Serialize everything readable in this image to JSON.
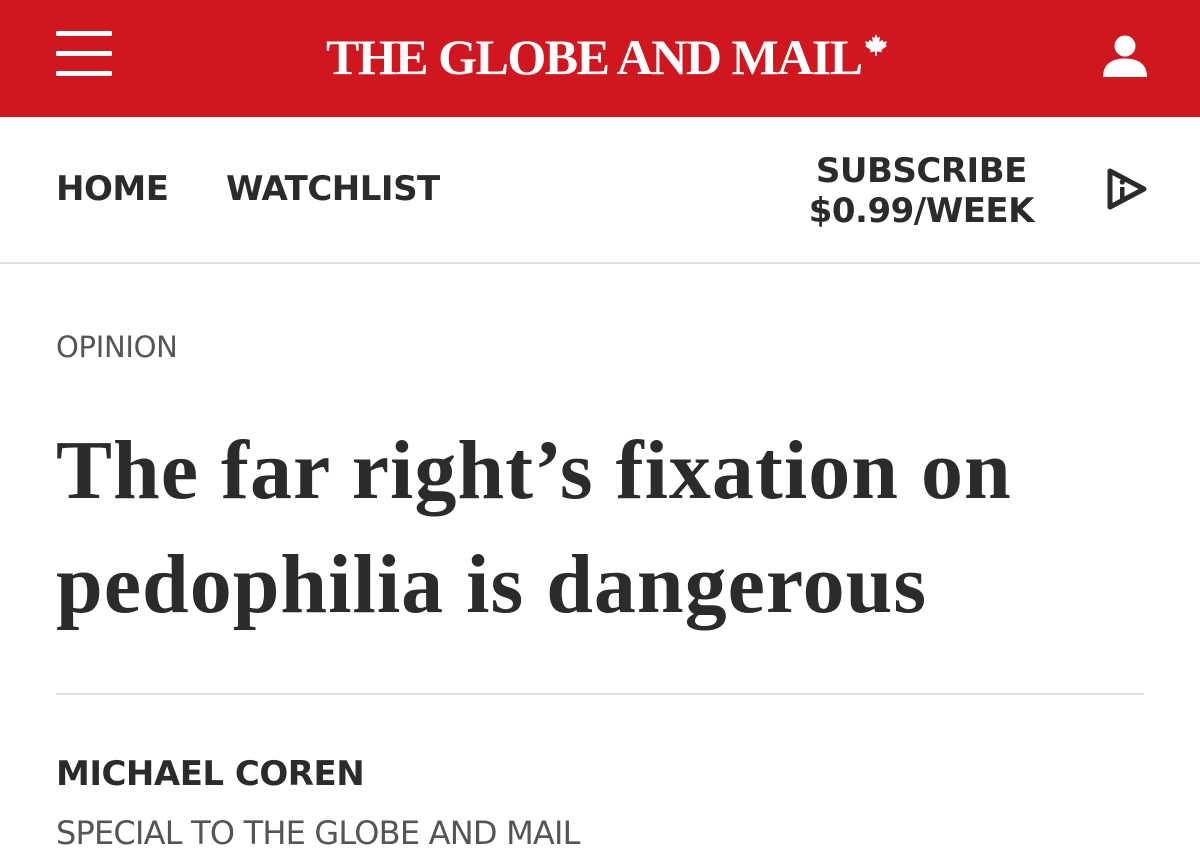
{
  "masthead": {
    "logo_text": "THE GLOBE AND MAIL",
    "menu_icon": "hamburger-menu-icon",
    "logo_icon": "maple-leaf-icon",
    "account_icon": "user-account-icon",
    "background_color": "#d0161e"
  },
  "nav": {
    "home_label": "HOME",
    "watchlist_label": "WATCHLIST",
    "subscribe_line1": "SUBSCRIBE",
    "subscribe_line2": "$0.99/WEEK",
    "play_icon": "audio-play-icon"
  },
  "article": {
    "section": "OPINION",
    "headline": "The far right’s fixation on pedophilia is dangerous",
    "author": "MICHAEL COREN",
    "author_credit": "SPECIAL TO THE GLOBE AND MAIL"
  }
}
